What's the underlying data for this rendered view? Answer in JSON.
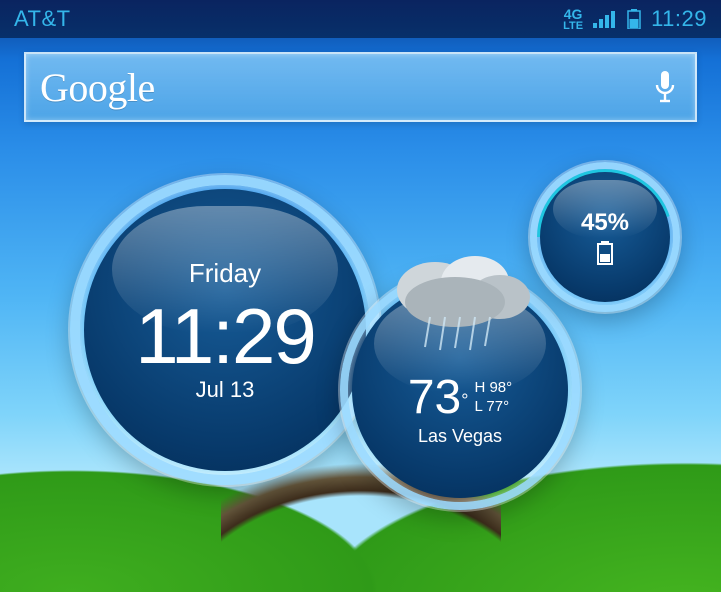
{
  "status_bar": {
    "carrier": "AT&T",
    "network_label_top": "4G",
    "network_label_bottom": "LTE",
    "signal_bars": 4,
    "battery_icon_level_pct": 55,
    "time": "11:29"
  },
  "search": {
    "provider_logo_text": "Google",
    "voice_icon": "microphone-icon"
  },
  "widgets": {
    "clock": {
      "day_of_week": "Friday",
      "time": "11:29",
      "date": "Jul 13"
    },
    "weather": {
      "condition": "rain",
      "temp": "73",
      "temp_unit": "°",
      "high_label": "H 98°",
      "low_label": "L 77°",
      "location": "Las Vegas"
    },
    "battery": {
      "percent_label": "45%",
      "level_pct": 45
    }
  }
}
